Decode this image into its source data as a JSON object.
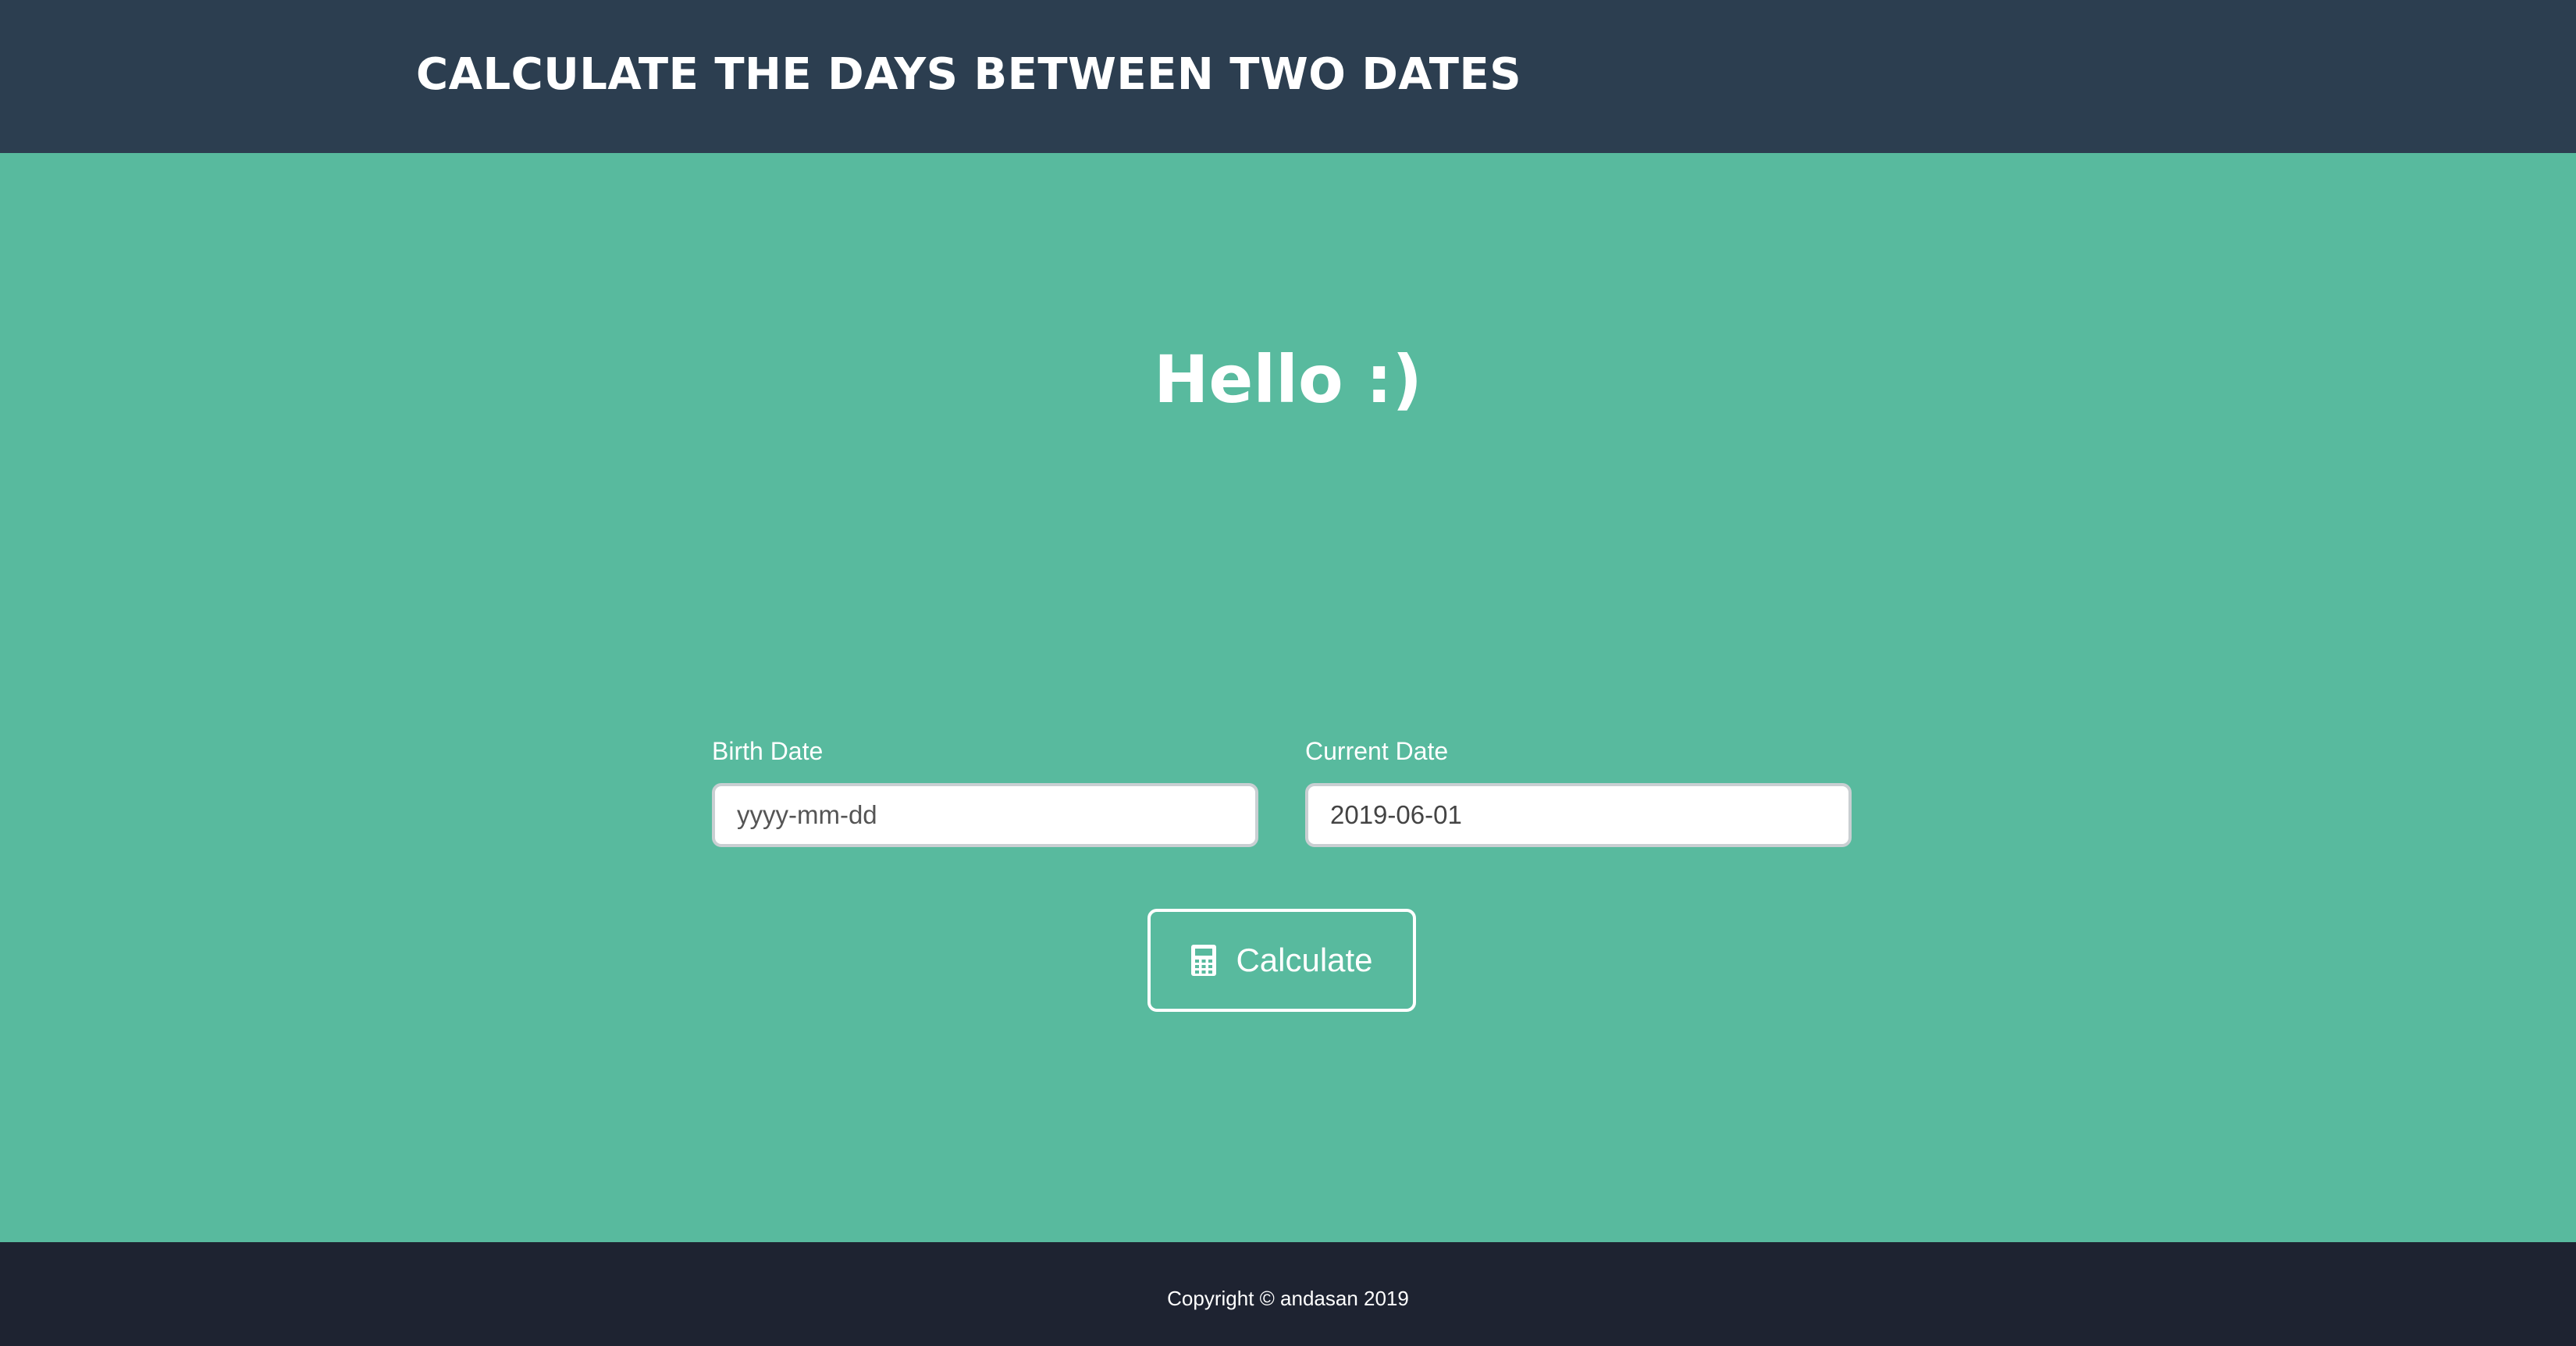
{
  "navbar": {
    "brand": "CALCULATE THE DAYS BETWEEN TWO DATES"
  },
  "masthead": {
    "heading": "Hello :)"
  },
  "form": {
    "birth_date": {
      "label": "Birth Date",
      "value": "",
      "placeholder": "yyyy-mm-dd"
    },
    "current_date": {
      "label": "Current Date",
      "value": "2019-06-01",
      "placeholder": "yyyy-mm-dd"
    },
    "calculate_button": {
      "icon": "calculator-icon",
      "label": "Calculate"
    }
  },
  "footer": {
    "copyright": "Copyright © andasan 2019"
  },
  "colors": {
    "navbar_bg": "#2c3e50",
    "masthead_bg": "#58ba9e",
    "footer_bg": "#1e2331",
    "text": "#ffffff"
  }
}
